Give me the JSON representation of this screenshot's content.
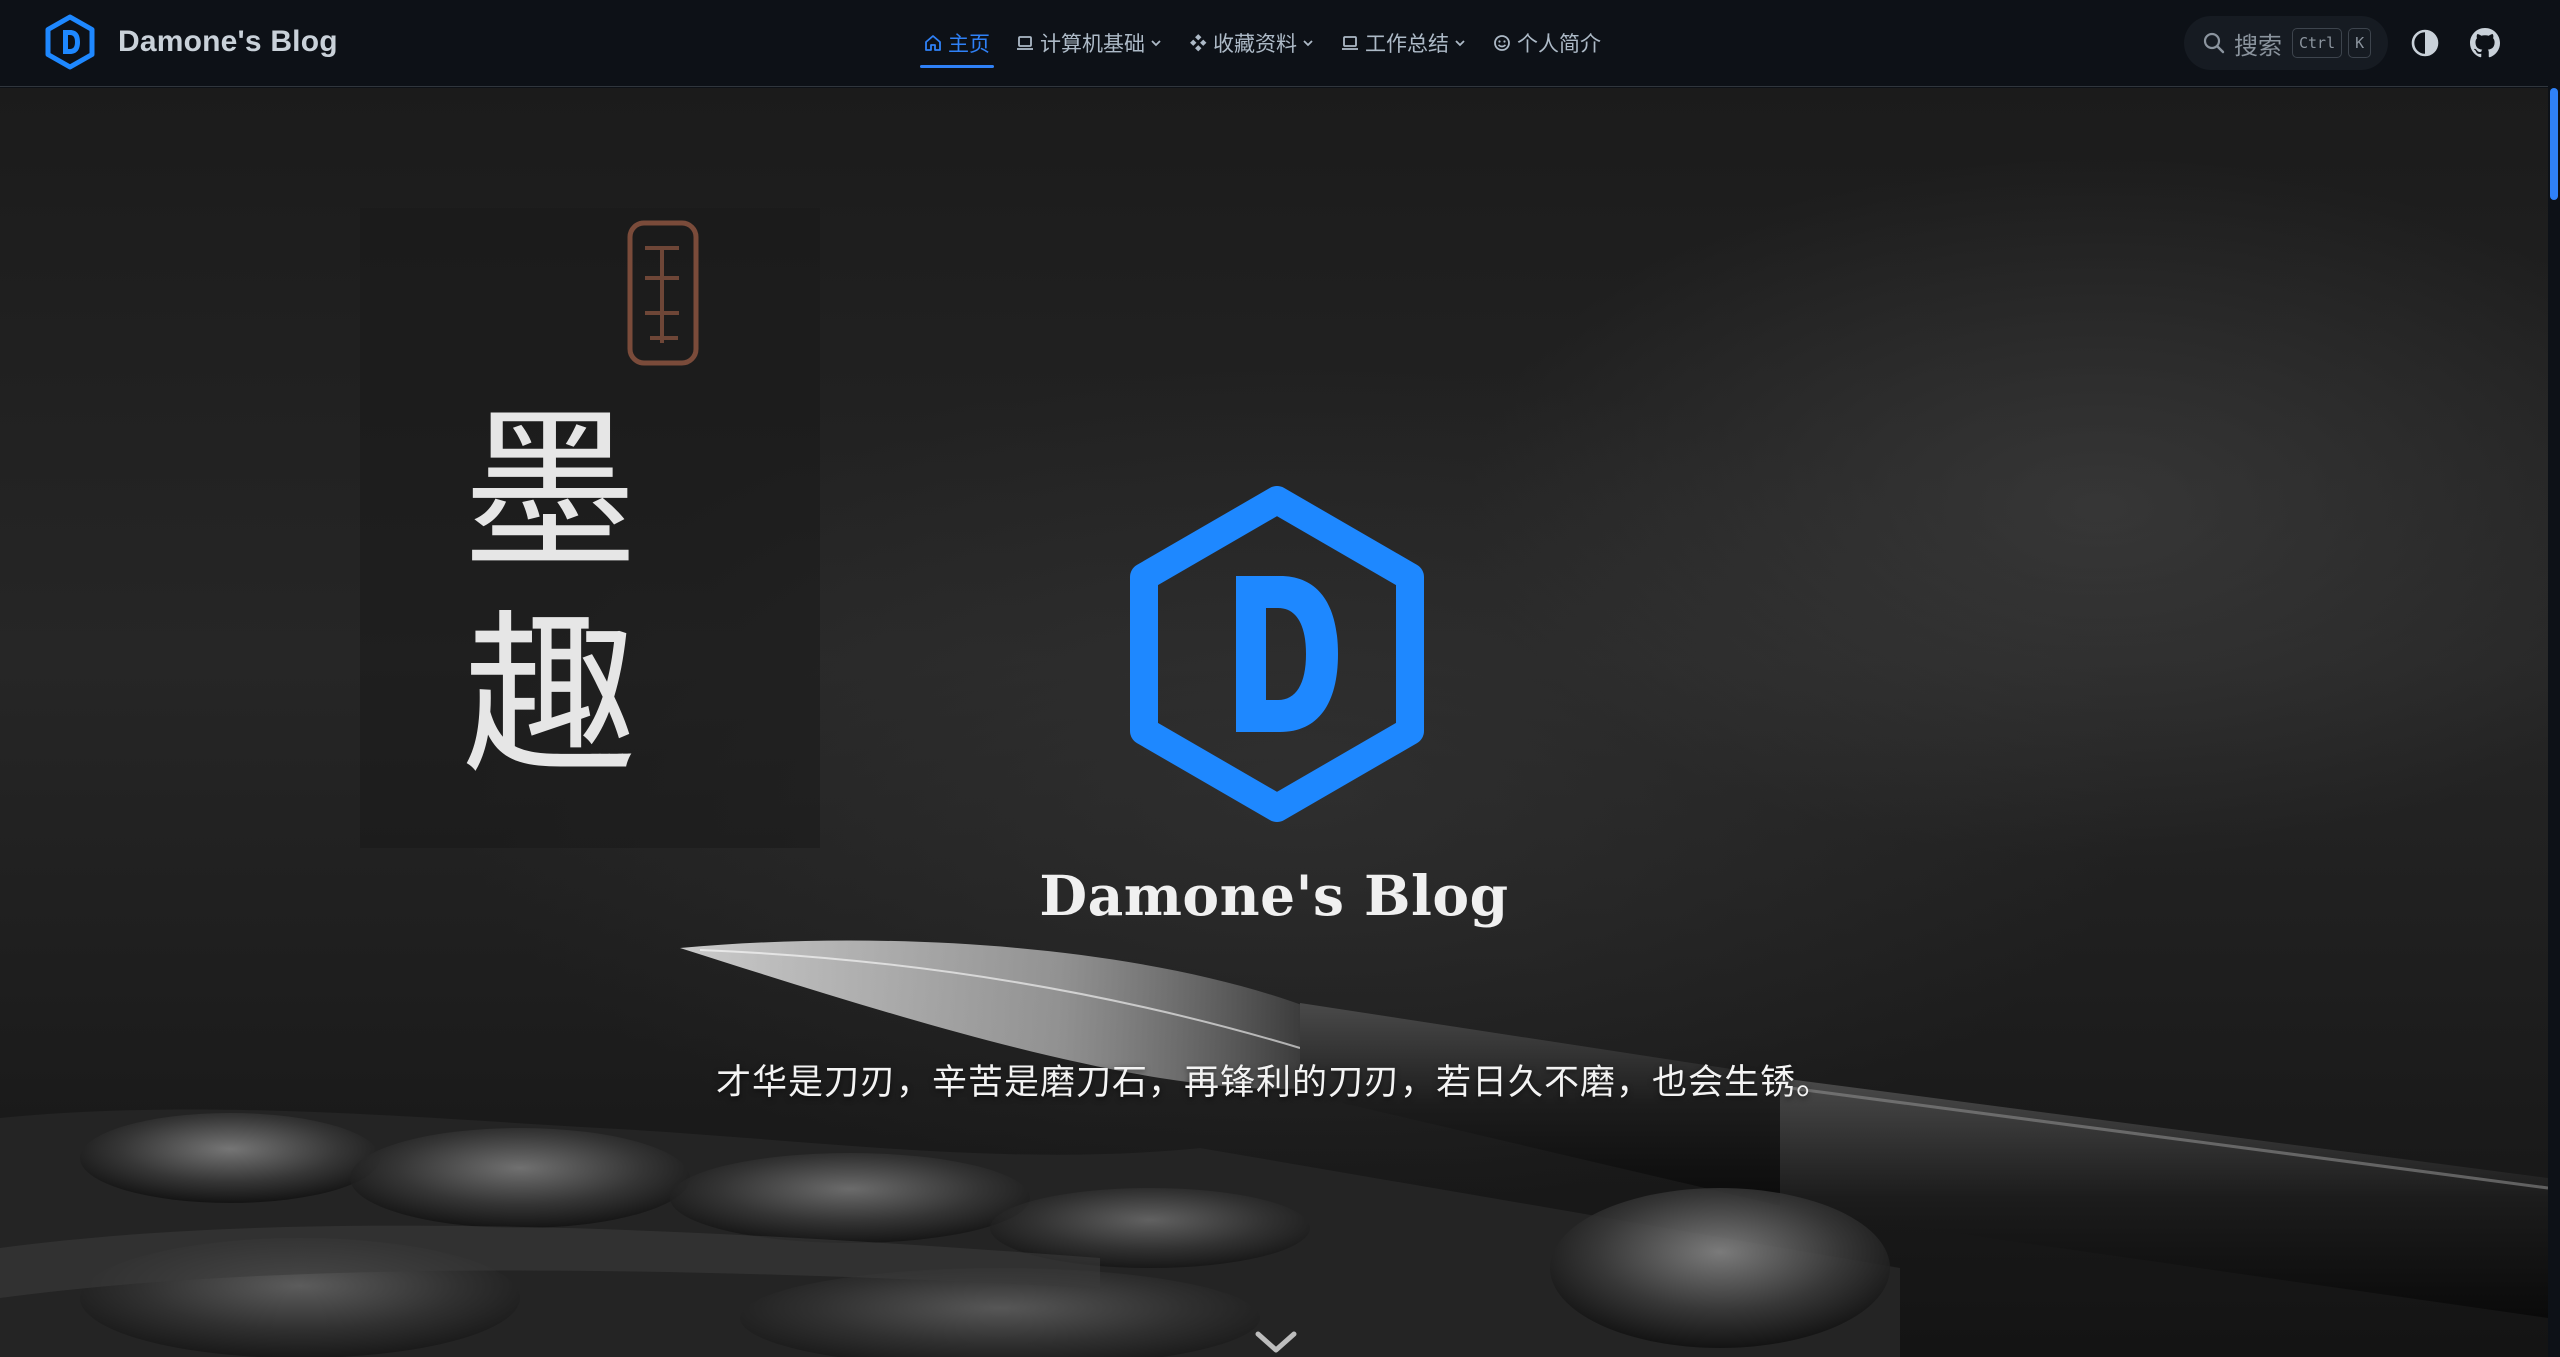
{
  "brand": {
    "title": "Damone's Blog",
    "logo_icon": "hexagon-d-logo-icon",
    "accent_color": "#2f81f7"
  },
  "nav": {
    "items": [
      {
        "label": "主页",
        "icon": "home-icon",
        "active": true,
        "has_dropdown": false
      },
      {
        "label": "计算机基础",
        "icon": "laptop-icon",
        "active": false,
        "has_dropdown": true
      },
      {
        "label": "收藏资料",
        "icon": "diamond-grid-icon",
        "active": false,
        "has_dropdown": true
      },
      {
        "label": "工作总结",
        "icon": "laptop-icon",
        "active": false,
        "has_dropdown": true
      },
      {
        "label": "个人简介",
        "icon": "smile-icon",
        "active": false,
        "has_dropdown": false
      }
    ]
  },
  "search": {
    "label": "搜索",
    "shortcut_keys": [
      "Ctrl",
      "K"
    ]
  },
  "toolbar": {
    "theme_toggle_icon": "contrast-icon",
    "github_icon": "github-icon"
  },
  "hero": {
    "title": "Damone's Blog",
    "tagline": "才华是刀刃，辛苦是磨刀石，再锋利的刀刃，若日久不磨，也会生锈。",
    "calligraphy": [
      "墨",
      "趣"
    ],
    "background_theme": "ink brush on inkstone, monochrome",
    "scroll_icon": "chevron-down-icon"
  },
  "colors": {
    "navbar_bg": "#0d1117",
    "nav_text": "#adbac7",
    "accent": "#2f81f7",
    "logo_blue": "#1e88ff"
  }
}
